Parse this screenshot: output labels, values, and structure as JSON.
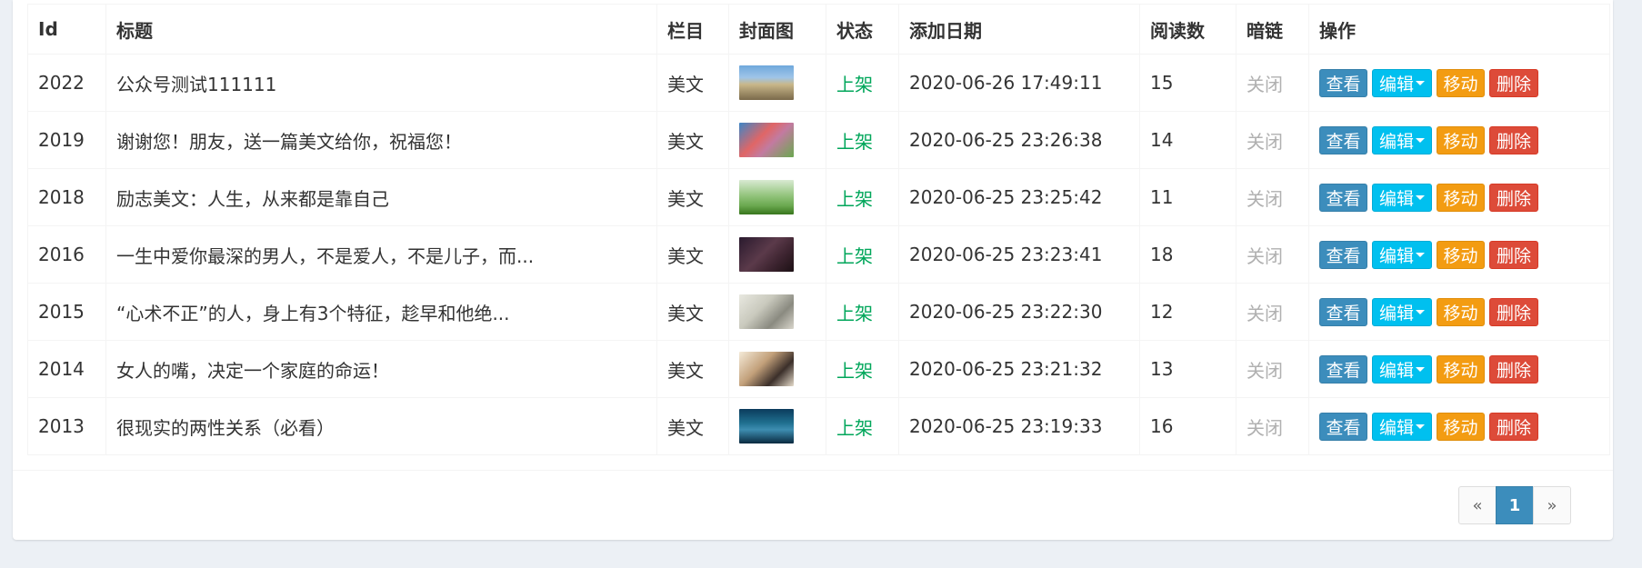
{
  "table": {
    "headers": [
      "Id",
      "标题",
      "栏目",
      "封面图",
      "状态",
      "添加日期",
      "阅读数",
      "暗链",
      "操作"
    ],
    "rows": [
      {
        "id": "2022",
        "title": "公众号测试111111",
        "category": "美文",
        "status": "上架",
        "date": "2020-06-26 17:49:11",
        "reads": "15",
        "dark": "关闭"
      },
      {
        "id": "2019",
        "title": "谢谢您！朋友，送一篇美文给你，祝福您！",
        "category": "美文",
        "status": "上架",
        "date": "2020-06-25 23:26:38",
        "reads": "14",
        "dark": "关闭"
      },
      {
        "id": "2018",
        "title": "励志美文：人生，从来都是靠自己",
        "category": "美文",
        "status": "上架",
        "date": "2020-06-25 23:25:42",
        "reads": "11",
        "dark": "关闭"
      },
      {
        "id": "2016",
        "title": "一生中爱你最深的男人，不是爱人，不是儿子，而...",
        "category": "美文",
        "status": "上架",
        "date": "2020-06-25 23:23:41",
        "reads": "18",
        "dark": "关闭"
      },
      {
        "id": "2015",
        "title": "“心术不正”的人，身上有3个特征，趁早和他绝...",
        "category": "美文",
        "status": "上架",
        "date": "2020-06-25 23:22:30",
        "reads": "12",
        "dark": "关闭"
      },
      {
        "id": "2014",
        "title": "女人的嘴，决定一个家庭的命运！",
        "category": "美文",
        "status": "上架",
        "date": "2020-06-25 23:21:32",
        "reads": "13",
        "dark": "关闭"
      },
      {
        "id": "2013",
        "title": "很现实的两性关系（必看）",
        "category": "美文",
        "status": "上架",
        "date": "2020-06-25 23:19:33",
        "reads": "16",
        "dark": "关闭"
      }
    ],
    "actions": {
      "view": "查看",
      "edit": "编辑",
      "move": "移动",
      "delete": "删除"
    }
  },
  "pagination": {
    "prev": "«",
    "current": "1",
    "next": "»"
  },
  "colors": {
    "status_up": "#00a65a",
    "btn_view": "#3c8dbc",
    "btn_edit": "#00c0ef",
    "btn_move": "#f39c12",
    "btn_delete": "#dd4b39",
    "page_active": "#3c8dbc"
  }
}
